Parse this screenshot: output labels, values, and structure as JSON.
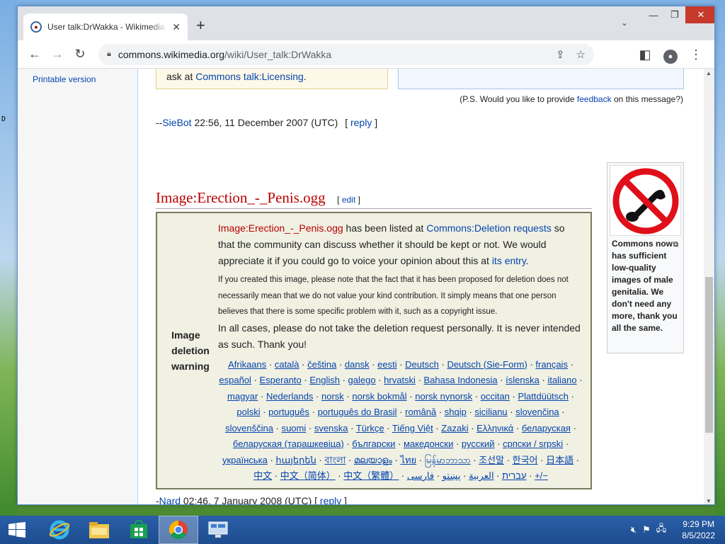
{
  "browser": {
    "tab_title": "User talk:DrWakka - Wikimedia Commons",
    "tab_close": "✕",
    "new_tab": "+",
    "url_host": "commons.wikimedia.org",
    "url_path": "/wiki/User_talk:DrWakka",
    "win_min": "—",
    "win_max": "❐",
    "win_close": "✕"
  },
  "sidebar": {
    "printable_version": "Printable version"
  },
  "licensing_box": {
    "text_prefix": "ask at ",
    "link": "Commons talk:Licensing",
    "text_suffix": "."
  },
  "ps_note": {
    "prefix": "(P.S. Would you like to provide ",
    "link": "feedback",
    "suffix": " on this message?)"
  },
  "signature1": {
    "prefix": "--",
    "user": "SieBot",
    "timestamp": " 22:56, 11 December 2007 (UTC)",
    "reply_open": "[ ",
    "reply": "reply",
    "reply_close": " ]"
  },
  "section": {
    "heading": "Image:Erection_-_Penis.ogg",
    "edit_open": "[ ",
    "edit": "edit",
    "edit_close": " ]"
  },
  "thumbnail": {
    "caption": "Commons now has sufficient low-quality images of male genitalia. We don't need any more, thank you all the same."
  },
  "warning": {
    "label_lines": [
      "Image",
      "deletion",
      "warning"
    ],
    "file_link": "Image:Erection_-_Penis.ogg",
    "p1_mid": " has been listed at ",
    "dr_link": "Commons:Deletion requests",
    "p1_end": " so that the community can discuss whether it should be kept or not. We would appreciate it if you could go to voice your opinion about this at ",
    "entry_link": "its entry",
    "p1_period": ".",
    "small_text": "If you created this image, please note that the fact that it has been proposed for deletion does not necessarily mean that we do not value your kind contribution. It simply means that one person believes that there is some specific problem with it, such as a copyright issue.",
    "p3": "In all cases, please do not take the deletion request personally. It is never intended as such. Thank you!",
    "languages": [
      "Afrikaans",
      "català",
      "čeština",
      "dansk",
      "eesti",
      "Deutsch",
      "Deutsch (Sie-Form)",
      "français",
      "español",
      "Esperanto",
      "English",
      "galego",
      "hrvatski",
      "Bahasa Indonesia",
      "íslenska",
      "italiano",
      "magyar",
      "Nederlands",
      "norsk",
      "norsk bokmål",
      "norsk nynorsk",
      "occitan",
      "Plattdüütsch",
      "polski",
      "português",
      "português do Brasil",
      "română",
      "shqip",
      "sicilianu",
      "slovenčina",
      "slovenščina",
      "suomi",
      "svenska",
      "Türkçe",
      "Tiếng Việt",
      "Zazaki",
      "Ελληνικά",
      "беларуская",
      "беларуская (тарашкевіца)",
      "български",
      "македонски",
      "русский",
      "српски / srpski",
      "українська",
      "հայերեն",
      "বাংলা",
      "മലയാളം",
      "ไทย",
      "မြန်မာဘာသာ",
      "조선말",
      "한국어",
      "日本語",
      "中文",
      "中文（简体）",
      "中文（繁體）",
      "עברית",
      "العربية",
      "پښتو",
      "فارسی",
      "+/−"
    ]
  },
  "signature2": {
    "prefix": "-",
    "user": "Nard",
    "timestamp": " 02:46, 7 January 2008 (UTC)",
    "reply_open": "[ ",
    "reply": "reply",
    "reply_close": " ]"
  },
  "taskbar": {
    "time": "9:29 PM",
    "date": "8/5/2022"
  }
}
